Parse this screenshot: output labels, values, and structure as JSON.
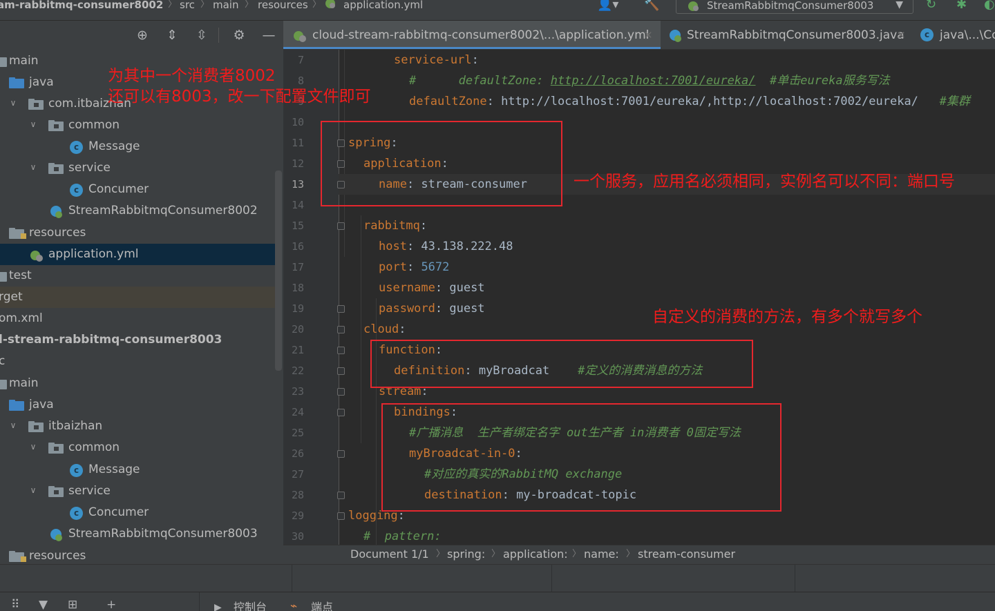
{
  "navbar": {
    "crumbs": [
      "am-rabbitmq-consumer8002",
      "src",
      "main",
      "resources",
      "application.yml"
    ],
    "run_config": "StreamRabbitmqConsumer8003"
  },
  "project_tree": [
    {
      "label": "main",
      "kind": "folder-plain",
      "expanded": true
    },
    {
      "label": "java",
      "kind": "folder-src"
    },
    {
      "label": "com.itbaizhan",
      "kind": "package",
      "expanded": true
    },
    {
      "label": "common",
      "kind": "package",
      "expanded": true
    },
    {
      "label": "Message",
      "kind": "class"
    },
    {
      "label": "service",
      "kind": "package",
      "expanded": true
    },
    {
      "label": "Concumer",
      "kind": "class"
    },
    {
      "label": "StreamRabbitmqConsumer8002",
      "kind": "spring-class"
    },
    {
      "label": "resources",
      "kind": "folder-res"
    },
    {
      "label": "application.yml",
      "kind": "yml",
      "selected": true
    },
    {
      "label": "test",
      "kind": "folder-plain"
    },
    {
      "label": "rget",
      "kind": "folder-plain"
    },
    {
      "label": "om.xml",
      "kind": "file"
    },
    {
      "label": "l-stream-rabbitmq-consumer8003",
      "kind": "module"
    },
    {
      "label": "c",
      "kind": "folder-plain"
    },
    {
      "label": "main",
      "kind": "folder-plain",
      "expanded": true
    },
    {
      "label": "java",
      "kind": "folder-src"
    },
    {
      "label": "itbaizhan",
      "kind": "package",
      "expanded": true
    },
    {
      "label": "common",
      "kind": "package",
      "expanded": true
    },
    {
      "label": "Message",
      "kind": "class"
    },
    {
      "label": "service",
      "kind": "package",
      "expanded": true
    },
    {
      "label": "Concumer",
      "kind": "class"
    },
    {
      "label": "StreamRabbitmqConsumer8003",
      "kind": "spring-class"
    },
    {
      "label": "resources",
      "kind": "folder-res"
    }
  ],
  "editor_tabs": [
    {
      "label": "cloud-stream-rabbitmq-consumer8002\\...\\application.yml",
      "active": true
    },
    {
      "label": "StreamRabbitmqConsumer8003.java",
      "active": false
    },
    {
      "label": "java\\...\\Co",
      "active": false
    }
  ],
  "code": {
    "current_line": 13,
    "lines": [
      {
        "n": "7",
        "parts": [
          [
            "k",
            "service-url"
          ],
          [
            "p",
            ":"
          ]
        ]
      },
      {
        "n": "8",
        "parts": [
          [
            "c",
            "#      defaultZone: "
          ],
          [
            "cu",
            "http://localhost:7001/eureka/"
          ],
          [
            "c",
            "  #单击eureka服务写法"
          ]
        ]
      },
      {
        "n": "9",
        "parts": [
          [
            "k",
            "defaultZone"
          ],
          [
            "p",
            ": http://localhost:7001/eureka/,http://localhost:7002/eureka/   "
          ],
          [
            "c",
            "#集群"
          ]
        ]
      },
      {
        "n": "10",
        "parts": []
      },
      {
        "n": "11",
        "parts": [
          [
            "k",
            "spring"
          ],
          [
            "p",
            ":"
          ]
        ]
      },
      {
        "n": "12",
        "parts": [
          [
            "k",
            "application"
          ],
          [
            "p",
            ":"
          ]
        ]
      },
      {
        "n": "13",
        "parts": [
          [
            "k",
            "name"
          ],
          [
            "p",
            ": stream-consumer"
          ]
        ]
      },
      {
        "n": "14",
        "parts": []
      },
      {
        "n": "15",
        "parts": [
          [
            "k",
            "rabbitmq"
          ],
          [
            "p",
            ":"
          ]
        ]
      },
      {
        "n": "16",
        "parts": [
          [
            "k",
            "host"
          ],
          [
            "p",
            ": 43.138.222.48"
          ]
        ]
      },
      {
        "n": "17",
        "parts": [
          [
            "k",
            "port"
          ],
          [
            "p",
            ": "
          ],
          [
            "n",
            "5672"
          ]
        ]
      },
      {
        "n": "18",
        "parts": [
          [
            "k",
            "username"
          ],
          [
            "p",
            ": guest"
          ]
        ]
      },
      {
        "n": "19",
        "parts": [
          [
            "k",
            "password"
          ],
          [
            "p",
            ": guest"
          ]
        ]
      },
      {
        "n": "20",
        "parts": [
          [
            "k",
            "cloud"
          ],
          [
            "p",
            ":"
          ]
        ]
      },
      {
        "n": "21",
        "parts": [
          [
            "k",
            "function"
          ],
          [
            "p",
            ":"
          ]
        ]
      },
      {
        "n": "22",
        "parts": [
          [
            "k",
            "definition"
          ],
          [
            "p",
            ": myBroadcat    "
          ],
          [
            "c",
            "#定义的消费消息的方法"
          ]
        ]
      },
      {
        "n": "23",
        "parts": [
          [
            "k",
            "stream"
          ],
          [
            "p",
            ":"
          ]
        ]
      },
      {
        "n": "24",
        "parts": [
          [
            "k",
            "bindings"
          ],
          [
            "p",
            ":"
          ]
        ]
      },
      {
        "n": "25",
        "parts": [
          [
            "c",
            "#广播消息  生产者绑定名字 out生产者 in消费者 0固定写法"
          ]
        ]
      },
      {
        "n": "26",
        "parts": [
          [
            "k",
            "myBroadcat-in-0"
          ],
          [
            "p",
            ":"
          ]
        ]
      },
      {
        "n": "27",
        "parts": [
          [
            "c",
            "#对应的真实的RabbitMQ exchange"
          ]
        ]
      },
      {
        "n": "28",
        "parts": [
          [
            "k",
            "destination"
          ],
          [
            "p",
            ": my-broadcat-topic"
          ]
        ]
      },
      {
        "n": "29",
        "parts": [
          [
            "k",
            "logging"
          ],
          [
            "p",
            ":"
          ]
        ]
      },
      {
        "n": "30",
        "parts": [
          [
            "c",
            "#  pattern:"
          ]
        ]
      }
    ]
  },
  "status_breadcrumb": [
    "Document 1/1",
    "spring:",
    "application:",
    "name:",
    "stream-consumer"
  ],
  "bottom_tools": {
    "console": "控制台",
    "endpoints": "端点"
  },
  "annotations": {
    "note_8003": "为其中一个消费者8002\n还可以有8003，改一下配置文件即可",
    "note_service": "一个服务，应用名必须相同，实例名可以不同：端口号",
    "note_method": "自定义的消费的方法，有多个就写多个"
  },
  "colors": {
    "annotation": "#f01c1c",
    "keyword": "#cc7832",
    "comment": "#629755",
    "number": "#6897bb",
    "text": "#a9b7c6",
    "selection": "#0d293e"
  }
}
